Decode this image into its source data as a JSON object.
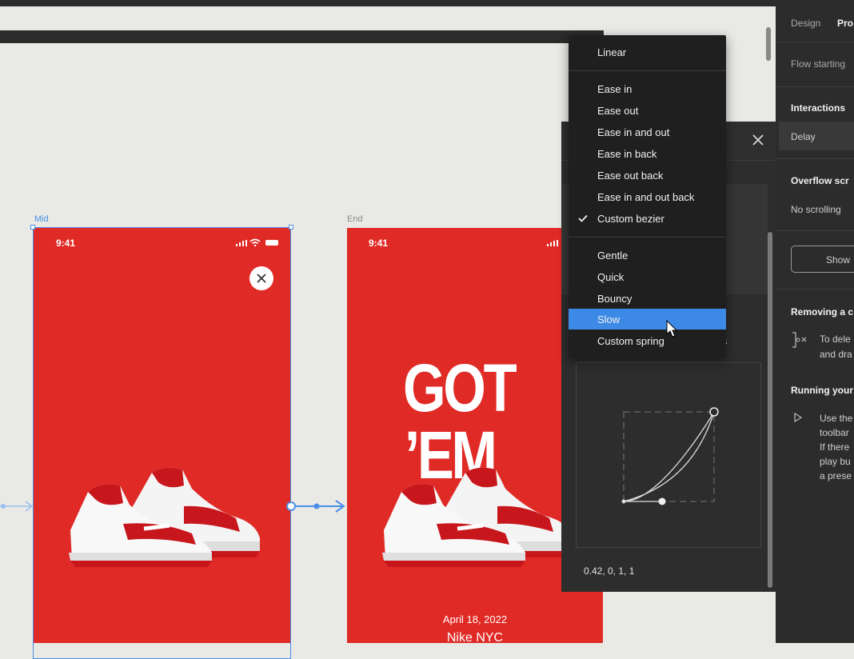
{
  "canvas": {
    "frames": [
      {
        "label": "Mid",
        "time": "9:41"
      },
      {
        "label": "End",
        "time": "9:41",
        "headline_line1": "GOT",
        "headline_line2": "’EM",
        "date": "April 18, 2022",
        "store": "Nike NYC"
      }
    ]
  },
  "right_panel": {
    "tabs": [
      "Design",
      "Pro"
    ],
    "flow_starting": "Flow starting",
    "interactions": "Interactions",
    "delay": "Delay",
    "overflow_title": "Overflow scr",
    "overflow_value": "No scrolling",
    "show_button": "Show",
    "removing_title": "Removing a c",
    "removing_text": [
      "To dele",
      "and dra"
    ],
    "running_title": "Running your",
    "running_text": [
      "Use the",
      "toolbar",
      "If there",
      "play bu",
      "a prese"
    ]
  },
  "interaction_panel": {
    "partial_text": "s",
    "bezier_values": "0.42, 0, 1, 1"
  },
  "easing_menu": {
    "items": [
      {
        "label": "Linear",
        "checked": false,
        "highlighted": false
      },
      {
        "label": "Ease in",
        "checked": false,
        "highlighted": false
      },
      {
        "label": "Ease out",
        "checked": false,
        "highlighted": false
      },
      {
        "label": "Ease in and out",
        "checked": false,
        "highlighted": false
      },
      {
        "label": "Ease in back",
        "checked": false,
        "highlighted": false
      },
      {
        "label": "Ease out back",
        "checked": false,
        "highlighted": false
      },
      {
        "label": "Ease in and out back",
        "checked": false,
        "highlighted": false
      },
      {
        "label": "Custom bezier",
        "checked": true,
        "highlighted": false
      },
      {
        "label": "Gentle",
        "checked": false,
        "highlighted": false
      },
      {
        "label": "Quick",
        "checked": false,
        "highlighted": false
      },
      {
        "label": "Bouncy",
        "checked": false,
        "highlighted": false
      },
      {
        "label": "Slow",
        "checked": false,
        "highlighted": true
      },
      {
        "label": "Custom spring",
        "checked": false,
        "highlighted": false
      }
    ]
  },
  "colors": {
    "accent": "#3d8ae6",
    "phone_red": "#e02a26",
    "selection": "#4b8ee8"
  }
}
